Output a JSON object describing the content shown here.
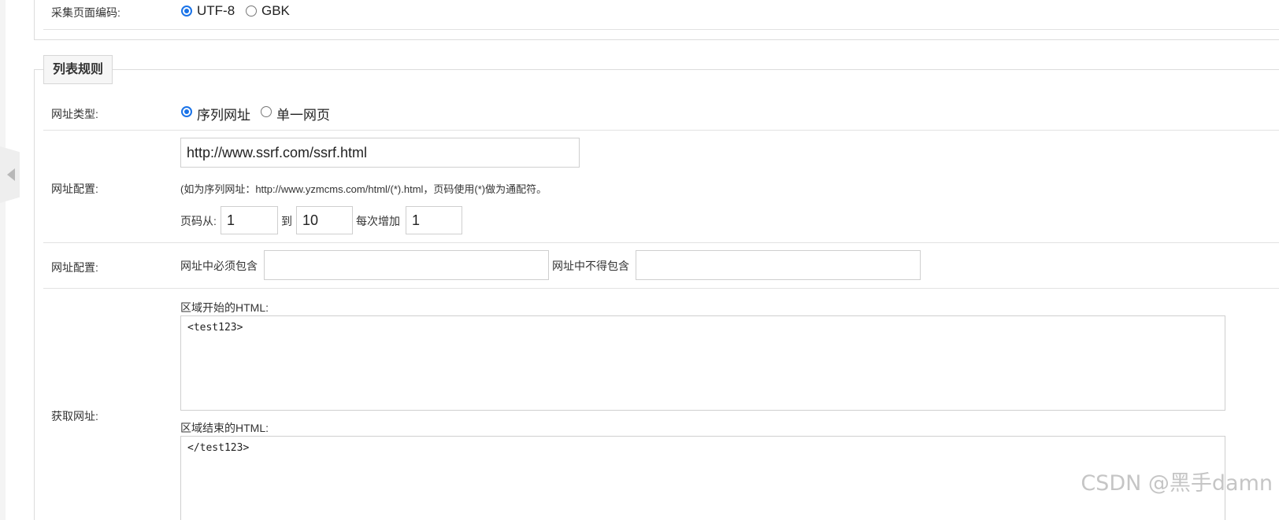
{
  "encoding": {
    "label": "采集页面编码:",
    "options": [
      {
        "label": "UTF-8",
        "checked": true
      },
      {
        "label": "GBK",
        "checked": false
      }
    ]
  },
  "list_rules": {
    "legend": "列表规则",
    "url_type": {
      "label": "网址类型:",
      "options": [
        {
          "label": "序列网址",
          "checked": true
        },
        {
          "label": "单一网页",
          "checked": false
        }
      ]
    },
    "url_config": {
      "label": "网址配置:",
      "url_value": "http://www.ssrf.com/ssrf.html",
      "hint": "(如为序列网址：http://www.yzmcms.com/html/(*).html，页码使用(*)做为通配符。",
      "page_from_label": "页码从:",
      "page_from": "1",
      "to_label": "到",
      "page_to": "10",
      "step_label": "每次增加",
      "step": "1"
    },
    "url_filter": {
      "label": "网址配置:",
      "must_include_label": "网址中必须包含",
      "must_include": "",
      "must_exclude_label": "网址中不得包含",
      "must_exclude": ""
    },
    "get_url": {
      "label": "获取网址:",
      "start_html_label": "区域开始的HTML:",
      "start_html": "<test123>",
      "end_html_label": "区域结束的HTML:",
      "end_html": "</test123>"
    }
  },
  "watermark": "CSDN @黑手damn"
}
